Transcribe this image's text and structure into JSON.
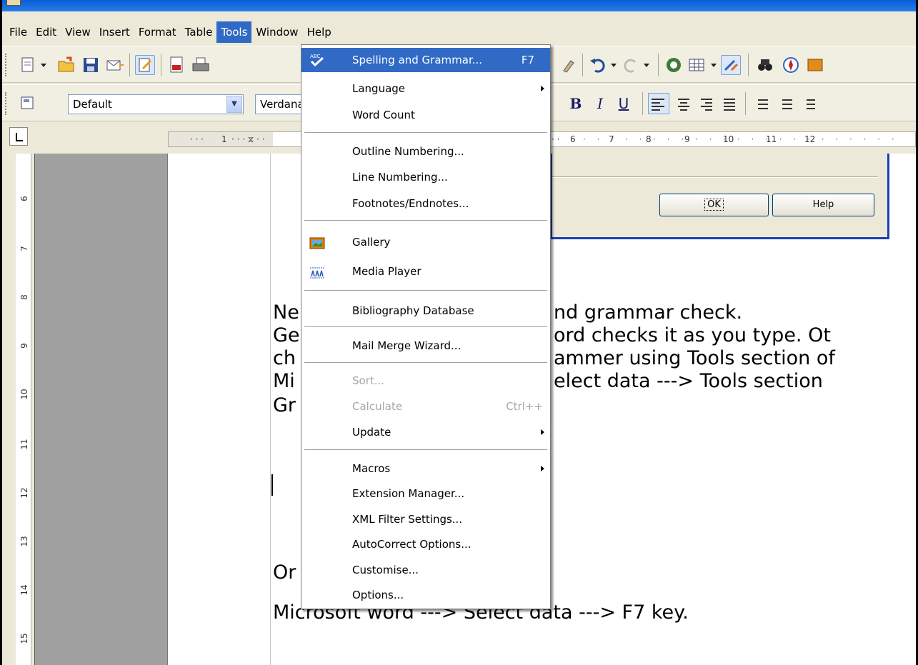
{
  "title_bar": {
    "text": ""
  },
  "menubar": {
    "items": [
      {
        "label": "File"
      },
      {
        "label": "Edit"
      },
      {
        "label": "View"
      },
      {
        "label": "Insert"
      },
      {
        "label": "Format"
      },
      {
        "label": "Table"
      },
      {
        "label": "Tools"
      },
      {
        "label": "Window"
      },
      {
        "label": "Help"
      }
    ]
  },
  "formatting": {
    "style_value": "Default",
    "font_value": "Verdana",
    "bold": "B",
    "italic": "I",
    "underline": "U"
  },
  "ruler": {
    "h_labels": [
      "1",
      "6",
      "7",
      "8",
      "9",
      "10",
      "11",
      "12"
    ],
    "v_labels": [
      "6",
      "7",
      "8",
      "9",
      "10",
      "11",
      "12",
      "13",
      "14",
      "15"
    ]
  },
  "dialog": {
    "ok_label": "OK",
    "help_label": "Help"
  },
  "document": {
    "lines": [
      "Ne",
      "Ge",
      "ch",
      "Mi",
      "Gr",
      "Or",
      "Microsoft word ---> Select data ---> F7 key."
    ],
    "right_fragments": [
      "nd grammar check.",
      "ord checks it as you type. Ot",
      "ammer using Tools section of",
      "elect data ---> Tools section"
    ]
  },
  "tools_menu": {
    "items": [
      {
        "label": "Spelling and Grammar...",
        "accel": "F7",
        "icon": "spellcheck-icon"
      },
      {
        "label": "Language",
        "submenu": true
      },
      {
        "label": "Word Count"
      },
      {
        "label": "Outline Numbering..."
      },
      {
        "label": "Line Numbering..."
      },
      {
        "label": "Footnotes/Endnotes..."
      },
      {
        "label": "Gallery",
        "icon": "gallery-icon"
      },
      {
        "label": "Media Player",
        "icon": "media-player-icon"
      },
      {
        "label": "Bibliography Database"
      },
      {
        "label": "Mail Merge Wizard..."
      },
      {
        "label": "Sort...",
        "disabled": true
      },
      {
        "label": "Calculate",
        "accel": "Ctrl++",
        "disabled": true
      },
      {
        "label": "Update",
        "submenu": true
      },
      {
        "label": "Macros",
        "submenu": true
      },
      {
        "label": "Extension Manager..."
      },
      {
        "label": "XML Filter Settings..."
      },
      {
        "label": "AutoCorrect Options..."
      },
      {
        "label": "Customise..."
      },
      {
        "label": "Options..."
      }
    ]
  },
  "colors": {
    "highlight": "#316ac5",
    "dialog_border": "#1a3fbb",
    "workspace": "#a0a0a0"
  }
}
